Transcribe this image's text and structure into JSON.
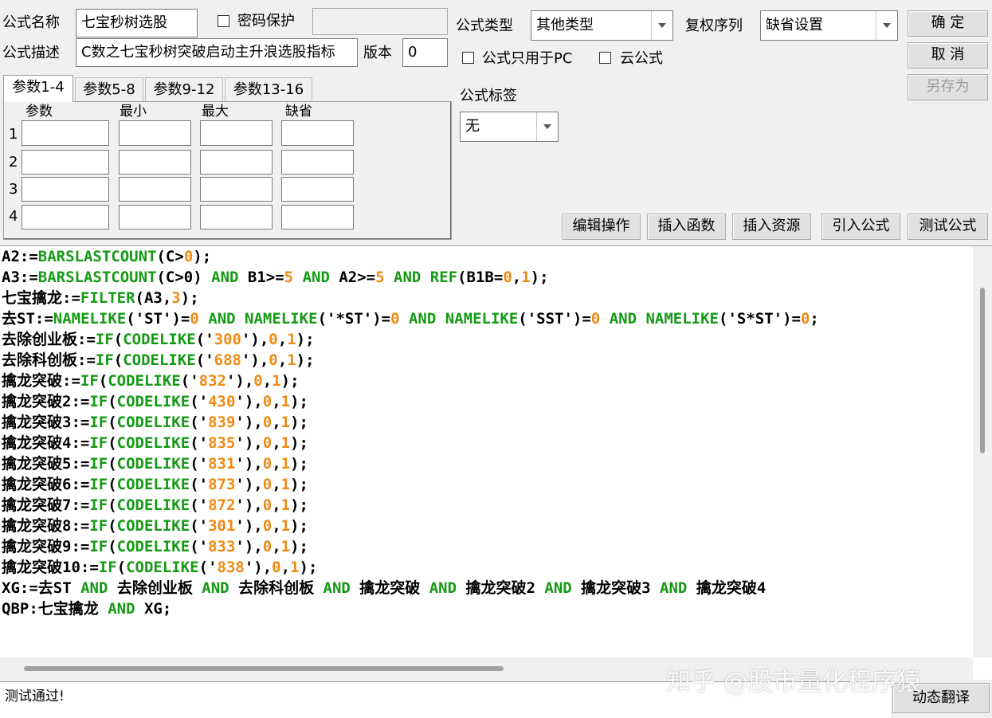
{
  "form": {
    "name_label": "公式名称",
    "name_value": "七宝秒树选股",
    "password_label": "密码保护",
    "desc_label": "公式描述",
    "desc_value": "C数之七宝秒树突破启动主升浪选股指标",
    "version_label": "版本",
    "version_value": "0",
    "type_label": "公式类型",
    "type_value": "其他类型",
    "rights_label": "复权序列",
    "rights_value": "缺省设置",
    "pc_only_label": "公式只用于PC",
    "cloud_label": "云公式",
    "tag_label": "公式标签",
    "tag_value": "无"
  },
  "buttons": {
    "ok": "确 定",
    "cancel": "取 消",
    "save_as": "另存为",
    "edit_ops": "编辑操作",
    "insert_func": "插入函数",
    "insert_res": "插入资源",
    "import_formula": "引入公式",
    "test_formula": "测试公式",
    "dynamic_translate": "动态翻译"
  },
  "params": {
    "tabs": [
      "参数1-4",
      "参数5-8",
      "参数9-12",
      "参数13-16"
    ],
    "headers": [
      "参数",
      "最小",
      "最大",
      "缺省"
    ],
    "rows": [
      "1",
      "2",
      "3",
      "4"
    ]
  },
  "code_lines": [
    [
      [
        "A2:=",
        ""
      ],
      [
        "BARSLASTCOUNT",
        "kw"
      ],
      [
        "(C>",
        ""
      ],
      [
        "0",
        "num"
      ],
      [
        ");",
        ""
      ]
    ],
    [
      [
        "A3:=",
        ""
      ],
      [
        "BARSLASTCOUNT",
        "kw"
      ],
      [
        "(C>0) ",
        ""
      ],
      [
        "AND",
        "kw"
      ],
      [
        " B1>=",
        ""
      ],
      [
        "5",
        "num"
      ],
      [
        " ",
        ""
      ],
      [
        "AND",
        "kw"
      ],
      [
        " A2>=",
        ""
      ],
      [
        "5",
        "num"
      ],
      [
        " ",
        ""
      ],
      [
        "AND",
        "kw"
      ],
      [
        " ",
        ""
      ],
      [
        "REF",
        "kw"
      ],
      [
        "(B1B=",
        ""
      ],
      [
        "0",
        "num"
      ],
      [
        ",",
        ""
      ],
      [
        "1",
        "num"
      ],
      [
        ");",
        ""
      ]
    ],
    [
      [
        "七宝擒龙:=",
        ""
      ],
      [
        "FILTER",
        "kw"
      ],
      [
        "(A3,",
        ""
      ],
      [
        "3",
        "num"
      ],
      [
        ");",
        ""
      ]
    ],
    [
      [
        "去ST:=",
        ""
      ],
      [
        "NAMELIKE",
        "kw"
      ],
      [
        "('ST')=",
        ""
      ],
      [
        "0",
        "num"
      ],
      [
        " ",
        ""
      ],
      [
        "AND",
        "kw"
      ],
      [
        " ",
        ""
      ],
      [
        "NAMELIKE",
        "kw"
      ],
      [
        "('*ST')=",
        ""
      ],
      [
        "0",
        "num"
      ],
      [
        " ",
        ""
      ],
      [
        "AND",
        "kw"
      ],
      [
        " ",
        ""
      ],
      [
        "NAMELIKE",
        "kw"
      ],
      [
        "('SST')=",
        ""
      ],
      [
        "0",
        "num"
      ],
      [
        " ",
        ""
      ],
      [
        "AND",
        "kw"
      ],
      [
        " ",
        ""
      ],
      [
        "NAMELIKE",
        "kw"
      ],
      [
        "('S*ST')=",
        ""
      ],
      [
        "0",
        "num"
      ],
      [
        ";",
        ""
      ]
    ],
    [
      [
        "去除创业板:=",
        ""
      ],
      [
        "IF",
        "kw"
      ],
      [
        "(",
        ""
      ],
      [
        "CODELIKE",
        "kw"
      ],
      [
        "('",
        ""
      ],
      [
        "300",
        "num"
      ],
      [
        "'),",
        ""
      ],
      [
        "0",
        "num"
      ],
      [
        ",",
        ""
      ],
      [
        "1",
        "num"
      ],
      [
        ");",
        ""
      ]
    ],
    [
      [
        "去除科创板:=",
        ""
      ],
      [
        "IF",
        "kw"
      ],
      [
        "(",
        ""
      ],
      [
        "CODELIKE",
        "kw"
      ],
      [
        "('",
        ""
      ],
      [
        "688",
        "num"
      ],
      [
        "'),",
        ""
      ],
      [
        "0",
        "num"
      ],
      [
        ",",
        ""
      ],
      [
        "1",
        "num"
      ],
      [
        ");",
        ""
      ]
    ],
    [
      [
        "擒龙突破:=",
        ""
      ],
      [
        "IF",
        "kw"
      ],
      [
        "(",
        ""
      ],
      [
        "CODELIKE",
        "kw"
      ],
      [
        "('",
        ""
      ],
      [
        "832",
        "num"
      ],
      [
        "'),",
        ""
      ],
      [
        "0",
        "num"
      ],
      [
        ",",
        ""
      ],
      [
        "1",
        "num"
      ],
      [
        ");",
        ""
      ]
    ],
    [
      [
        "擒龙突破2:=",
        ""
      ],
      [
        "IF",
        "kw"
      ],
      [
        "(",
        ""
      ],
      [
        "CODELIKE",
        "kw"
      ],
      [
        "('",
        ""
      ],
      [
        "430",
        "num"
      ],
      [
        "'),",
        ""
      ],
      [
        "0",
        "num"
      ],
      [
        ",",
        ""
      ],
      [
        "1",
        "num"
      ],
      [
        ");",
        ""
      ]
    ],
    [
      [
        "擒龙突破3:=",
        ""
      ],
      [
        "IF",
        "kw"
      ],
      [
        "(",
        ""
      ],
      [
        "CODELIKE",
        "kw"
      ],
      [
        "('",
        ""
      ],
      [
        "839",
        "num"
      ],
      [
        "'),",
        ""
      ],
      [
        "0",
        "num"
      ],
      [
        ",",
        ""
      ],
      [
        "1",
        "num"
      ],
      [
        ");",
        ""
      ]
    ],
    [
      [
        "擒龙突破4:=",
        ""
      ],
      [
        "IF",
        "kw"
      ],
      [
        "(",
        ""
      ],
      [
        "CODELIKE",
        "kw"
      ],
      [
        "('",
        ""
      ],
      [
        "835",
        "num"
      ],
      [
        "'),",
        ""
      ],
      [
        "0",
        "num"
      ],
      [
        ",",
        ""
      ],
      [
        "1",
        "num"
      ],
      [
        ");",
        ""
      ]
    ],
    [
      [
        "擒龙突破5:=",
        ""
      ],
      [
        "IF",
        "kw"
      ],
      [
        "(",
        ""
      ],
      [
        "CODELIKE",
        "kw"
      ],
      [
        "('",
        ""
      ],
      [
        "831",
        "num"
      ],
      [
        "'),",
        ""
      ],
      [
        "0",
        "num"
      ],
      [
        ",",
        ""
      ],
      [
        "1",
        "num"
      ],
      [
        ");",
        ""
      ]
    ],
    [
      [
        "擒龙突破6:=",
        ""
      ],
      [
        "IF",
        "kw"
      ],
      [
        "(",
        ""
      ],
      [
        "CODELIKE",
        "kw"
      ],
      [
        "('",
        ""
      ],
      [
        "873",
        "num"
      ],
      [
        "'),",
        ""
      ],
      [
        "0",
        "num"
      ],
      [
        ",",
        ""
      ],
      [
        "1",
        "num"
      ],
      [
        ");",
        ""
      ]
    ],
    [
      [
        "擒龙突破7:=",
        ""
      ],
      [
        "IF",
        "kw"
      ],
      [
        "(",
        ""
      ],
      [
        "CODELIKE",
        "kw"
      ],
      [
        "('",
        ""
      ],
      [
        "872",
        "num"
      ],
      [
        "'),",
        ""
      ],
      [
        "0",
        "num"
      ],
      [
        ",",
        ""
      ],
      [
        "1",
        "num"
      ],
      [
        ");",
        ""
      ]
    ],
    [
      [
        "擒龙突破8:=",
        ""
      ],
      [
        "IF",
        "kw"
      ],
      [
        "(",
        ""
      ],
      [
        "CODELIKE",
        "kw"
      ],
      [
        "('",
        ""
      ],
      [
        "301",
        "num"
      ],
      [
        "'),",
        ""
      ],
      [
        "0",
        "num"
      ],
      [
        ",",
        ""
      ],
      [
        "1",
        "num"
      ],
      [
        ");",
        ""
      ]
    ],
    [
      [
        "擒龙突破9:=",
        ""
      ],
      [
        "IF",
        "kw"
      ],
      [
        "(",
        ""
      ],
      [
        "CODELIKE",
        "kw"
      ],
      [
        "('",
        ""
      ],
      [
        "833",
        "num"
      ],
      [
        "'),",
        ""
      ],
      [
        "0",
        "num"
      ],
      [
        ",",
        ""
      ],
      [
        "1",
        "num"
      ],
      [
        ");",
        ""
      ]
    ],
    [
      [
        "擒龙突破10:=",
        ""
      ],
      [
        "IF",
        "kw"
      ],
      [
        "(",
        ""
      ],
      [
        "CODELIKE",
        "kw"
      ],
      [
        "('",
        ""
      ],
      [
        "838",
        "num"
      ],
      [
        "'),",
        ""
      ],
      [
        "0",
        "num"
      ],
      [
        ",",
        ""
      ],
      [
        "1",
        "num"
      ],
      [
        ");",
        ""
      ]
    ],
    [
      [
        "XG:=去ST ",
        ""
      ],
      [
        "AND",
        "kw"
      ],
      [
        " 去除创业板 ",
        ""
      ],
      [
        "AND",
        "kw"
      ],
      [
        " 去除科创板 ",
        ""
      ],
      [
        "AND",
        "kw"
      ],
      [
        " 擒龙突破 ",
        ""
      ],
      [
        "AND",
        "kw"
      ],
      [
        " 擒龙突破2 ",
        ""
      ],
      [
        "AND",
        "kw"
      ],
      [
        " 擒龙突破3 ",
        ""
      ],
      [
        "AND",
        "kw"
      ],
      [
        " 擒龙突破4",
        ""
      ]
    ],
    [
      [
        "QBP:七宝擒龙 ",
        ""
      ],
      [
        "AND",
        "kw"
      ],
      [
        " XG;",
        ""
      ]
    ]
  ],
  "status": {
    "message": "测试通过!"
  },
  "watermark": "知乎 @股市量化程序猿",
  "colors": {
    "keyword": "#159a15",
    "number": "#f08a14",
    "background": "#f0f0f0"
  }
}
